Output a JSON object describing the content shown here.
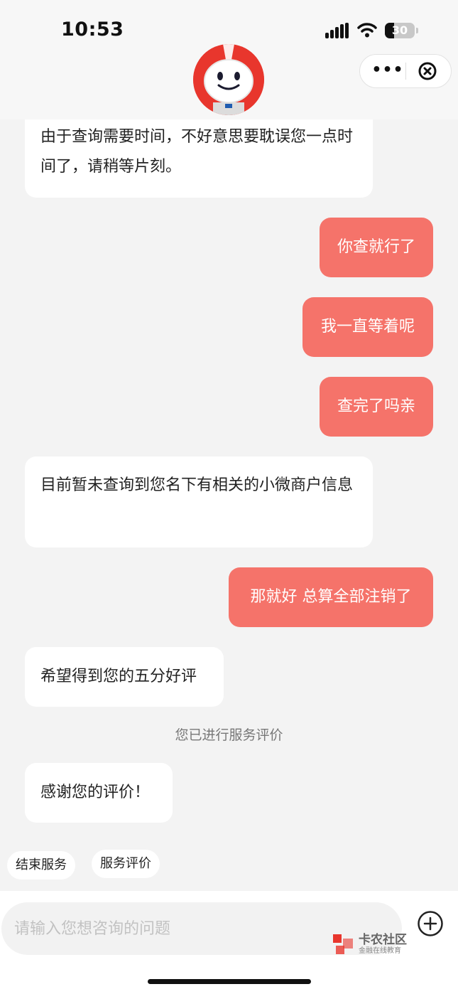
{
  "status_bar": {
    "time": "10:53",
    "battery": "30"
  },
  "header": {
    "more_label": "•••"
  },
  "messages": [
    {
      "from": "bot",
      "text": "由于查询需要时间，不好意思要耽误您一点时间了，请稍等片刻。"
    },
    {
      "from": "user",
      "text": "你查就行了"
    },
    {
      "from": "user",
      "text": "我一直等着呢"
    },
    {
      "from": "user",
      "text": "查完了吗亲"
    },
    {
      "from": "bot",
      "text": "目前暂未查询到您名下有相关的小微商户信息"
    },
    {
      "from": "user",
      "text": "那就好 总算全部注销了"
    },
    {
      "from": "bot",
      "text": "希望得到您的五分好评"
    },
    {
      "from": "bot",
      "text": "感谢您的评价！"
    }
  ],
  "system_note": "您已进行服务评价",
  "quick_actions": [
    {
      "label": "结束服务"
    },
    {
      "label": "服务评价"
    }
  ],
  "input": {
    "placeholder": "请输入您想咨询的问题"
  },
  "watermark": {
    "title": "卡农社区",
    "subtitle": "金融在线教育"
  },
  "colors": {
    "user_bubble": "#f5736a",
    "bot_bubble": "#ffffff",
    "background": "#f3f3f3",
    "brand_red": "#e8362d"
  }
}
